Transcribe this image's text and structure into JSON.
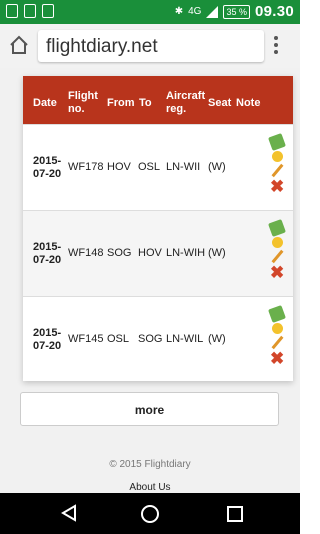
{
  "status_bar": {
    "time": "09.30",
    "battery": "35 %",
    "network": "4G"
  },
  "browser": {
    "url": "flightdiary.net",
    "home_icon": "home-icon",
    "menu_icon": "more-vert-icon"
  },
  "table": {
    "headers": [
      "Date",
      "Flight no.",
      "From",
      "To",
      "Aircraft reg.",
      "Seat",
      "Note"
    ],
    "rows": [
      {
        "date": "2015-07-20",
        "flight": "WF178",
        "from": "HOV",
        "to": "OSL",
        "reg": "LN-WII",
        "seat": "(W)",
        "note": ""
      },
      {
        "date": "2015-07-20",
        "flight": "WF148",
        "from": "SOG",
        "to": "HOV",
        "reg": "LN-WIH",
        "seat": "(W)",
        "note": ""
      },
      {
        "date": "2015-07-20",
        "flight": "WF145",
        "from": "OSL",
        "to": "SOG",
        "reg": "LN-WIL",
        "seat": "(W)",
        "note": ""
      }
    ],
    "row_actions": [
      "money-icon",
      "star-icon",
      "edit-icon",
      "delete-icon"
    ]
  },
  "more_label": "more",
  "footer": {
    "copyright": "© 2015 Flightdiary",
    "about": "About Us"
  },
  "colors": {
    "statusbar": "#1a8f3a",
    "table_header": "#b8341c"
  }
}
